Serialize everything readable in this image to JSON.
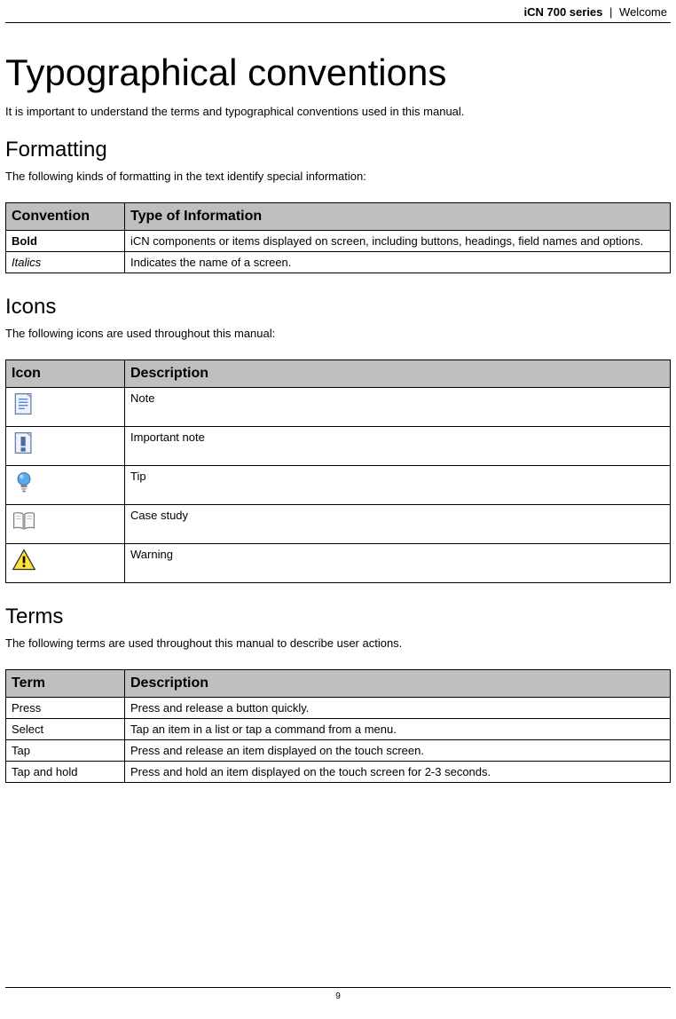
{
  "header": {
    "series": "iCN 700 series",
    "separator": "|",
    "section": "Welcome"
  },
  "title": "Typographical conventions",
  "intro": "It is important to understand the terms and typographical conventions used in this manual.",
  "formatting": {
    "heading": "Formatting",
    "intro": "The following kinds of formatting in the text identify special information:",
    "headers": {
      "col1": "Convention",
      "col2": "Type of Information"
    },
    "rows": [
      {
        "convention": "Bold",
        "info": "iCN components or items displayed on screen, including buttons, headings, field names and options."
      },
      {
        "convention": "Italics",
        "info": "Indicates the name of a screen."
      }
    ]
  },
  "icons": {
    "heading": "Icons",
    "intro": "The following icons are used throughout this manual:",
    "headers": {
      "col1": "Icon",
      "col2": "Description"
    },
    "rows": [
      {
        "name": "note-icon",
        "description": "Note"
      },
      {
        "name": "important-note-icon",
        "description": "Important note"
      },
      {
        "name": "tip-icon",
        "description": "Tip"
      },
      {
        "name": "case-study-icon",
        "description": "Case study"
      },
      {
        "name": "warning-icon",
        "description": "Warning"
      }
    ]
  },
  "terms": {
    "heading": "Terms",
    "intro": "The following terms are used throughout this manual to describe user actions.",
    "headers": {
      "col1": "Term",
      "col2": "Description"
    },
    "rows": [
      {
        "term": "Press",
        "description": "Press and release a button quickly."
      },
      {
        "term": "Select",
        "description": "Tap an item in a list or tap a command from a menu."
      },
      {
        "term": "Tap",
        "description": "Press and release an item displayed on the touch screen."
      },
      {
        "term": "Tap and hold",
        "description": "Press and hold an item displayed on the touch screen for 2-3 seconds."
      }
    ]
  },
  "footer": {
    "page_number": "9"
  }
}
